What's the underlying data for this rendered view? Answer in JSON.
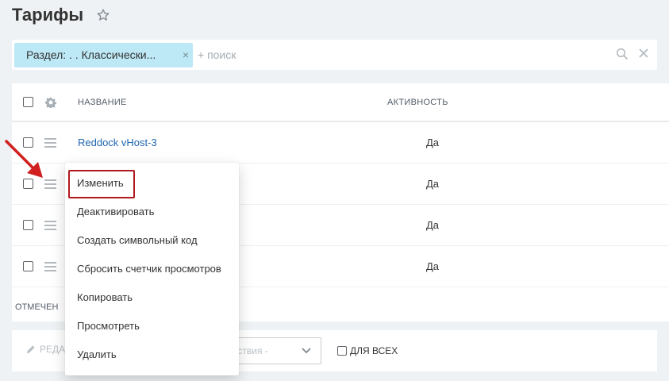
{
  "header": {
    "title": "Тарифы"
  },
  "filter": {
    "chip_label": "Раздел: . . Классически...",
    "chip_close": "×",
    "placeholder": "+ поиск"
  },
  "grid": {
    "columns": {
      "name": "Название",
      "active": "Активность"
    },
    "rows": [
      {
        "name": "Reddock vHost-3",
        "active": "Да"
      },
      {
        "name": "",
        "active": "Да"
      },
      {
        "name": "",
        "active": "Да"
      },
      {
        "name": "",
        "active": "Да"
      }
    ],
    "footer_label": "Отмечен"
  },
  "bottom_bar": {
    "edit_label": "Реда",
    "actions_label": "ействия -",
    "for_all_label": "для всех"
  },
  "context_menu": {
    "items": [
      "Изменить",
      "Деактивировать",
      "Создать символьный код",
      "Сбросить счетчик просмотров",
      "Копировать",
      "Просмотреть",
      "Удалить"
    ]
  },
  "colors": {
    "link": "#2067b0",
    "chip_bg": "#bde8f6",
    "highlight_border": "#b0191e",
    "arrow": "#d0201f"
  },
  "icons": [
    "star-icon",
    "search-icon",
    "clear-icon",
    "gear-icon",
    "drag-handle-icon",
    "pencil-icon",
    "chevron-down-icon",
    "arrow-pointer"
  ]
}
